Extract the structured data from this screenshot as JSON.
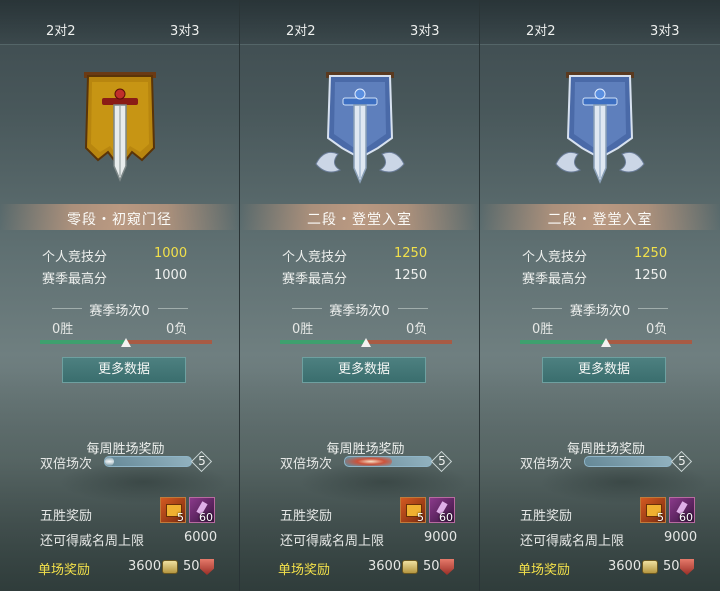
{
  "panels": [
    {
      "tabs": [
        "2对2",
        "3对3"
      ],
      "emblem": "gold-banner-sword-emblem",
      "rank_name": "零段・初窥门径",
      "personal_score_label": "个人竞技分",
      "personal_score": "1000",
      "season_high_label": "赛季最高分",
      "season_high": "1000",
      "season_matches": "赛季场次0",
      "wins": "0胜",
      "losses": "0负",
      "more_button": "更多数据",
      "weekly_title": "每周胜场奖励",
      "double_label": "双倍场次",
      "double_count": "5",
      "double_progress": 0.1,
      "five_win_label": "五胜奖励",
      "reward_chest_count": "5",
      "reward_scroll_count": "60",
      "cap_label": "还可得威名周上限",
      "cap_value": "6000",
      "single_label": "单场奖励",
      "single_coin": "3600",
      "single_honor": "50"
    },
    {
      "tabs": [
        "2对2",
        "3对3"
      ],
      "emblem": "blue-banner-sword-emblem",
      "rank_name": "二段・登堂入室",
      "personal_score_label": "个人竞技分",
      "personal_score": "1250",
      "season_high_label": "赛季最高分",
      "season_high": "1250",
      "season_matches": "赛季场次0",
      "wins": "0胜",
      "losses": "0负",
      "more_button": "更多数据",
      "weekly_title": "每周胜场奖励",
      "double_label": "双倍场次",
      "double_count": "5",
      "double_progress": 0.55,
      "five_win_label": "五胜奖励",
      "reward_chest_count": "5",
      "reward_scroll_count": "60",
      "cap_label": "还可得威名周上限",
      "cap_value": "9000",
      "single_label": "单场奖励",
      "single_coin": "3600",
      "single_honor": "50"
    },
    {
      "tabs": [
        "2对2",
        "3对3"
      ],
      "emblem": "blue-banner-sword-emblem",
      "rank_name": "二段・登堂入室",
      "personal_score_label": "个人竞技分",
      "personal_score": "1250",
      "season_high_label": "赛季最高分",
      "season_high": "1250",
      "season_matches": "赛季场次0",
      "wins": "0胜",
      "losses": "0负",
      "more_button": "更多数据",
      "weekly_title": "每周胜场奖励",
      "double_label": "双倍场次",
      "double_count": "5",
      "double_progress": 0.0,
      "five_win_label": "五胜奖励",
      "reward_chest_count": "5",
      "reward_scroll_count": "60",
      "cap_label": "还可得威名周上限",
      "cap_value": "9000",
      "single_label": "单场奖励",
      "single_coin": "3600",
      "single_honor": "50"
    }
  ],
  "colors": {
    "score_yellow": "#f2e04a",
    "win_bar": "#3ea06e",
    "loss_bar": "#a85b44",
    "button": "#3f7373"
  }
}
